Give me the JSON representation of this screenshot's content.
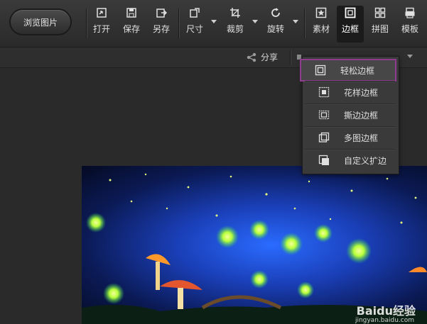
{
  "toolbar": {
    "browse_label": "浏览图片",
    "tools": [
      {
        "label": "打开",
        "icon": "open-icon"
      },
      {
        "label": "保存",
        "icon": "save-icon"
      },
      {
        "label": "另存",
        "icon": "save-as-icon"
      },
      {
        "label": "尺寸",
        "icon": "resize-icon"
      },
      {
        "label": "裁剪",
        "icon": "crop-icon"
      },
      {
        "label": "旋转",
        "icon": "rotate-icon"
      },
      {
        "label": "素材",
        "icon": "material-icon"
      },
      {
        "label": "边框",
        "icon": "border-icon"
      },
      {
        "label": "拼图",
        "icon": "puzzle-icon"
      },
      {
        "label": "模板",
        "icon": "template-icon"
      }
    ],
    "active_tool": "边框"
  },
  "subbar": {
    "share_label": "分享"
  },
  "border_menu": {
    "items": [
      {
        "label": "轻松边框",
        "icon": "simple-border-icon"
      },
      {
        "label": "花样边框",
        "icon": "pattern-border-icon"
      },
      {
        "label": "撕边边框",
        "icon": "torn-border-icon"
      },
      {
        "label": "多图边框",
        "icon": "multi-image-border-icon"
      },
      {
        "label": "自定义扩边",
        "icon": "custom-expand-icon"
      }
    ],
    "selected": "轻松边框",
    "highlight_color": "#8e3d8e"
  },
  "watermark": {
    "brand": "Baidu经验",
    "url": "jingyan.baidu.com"
  }
}
